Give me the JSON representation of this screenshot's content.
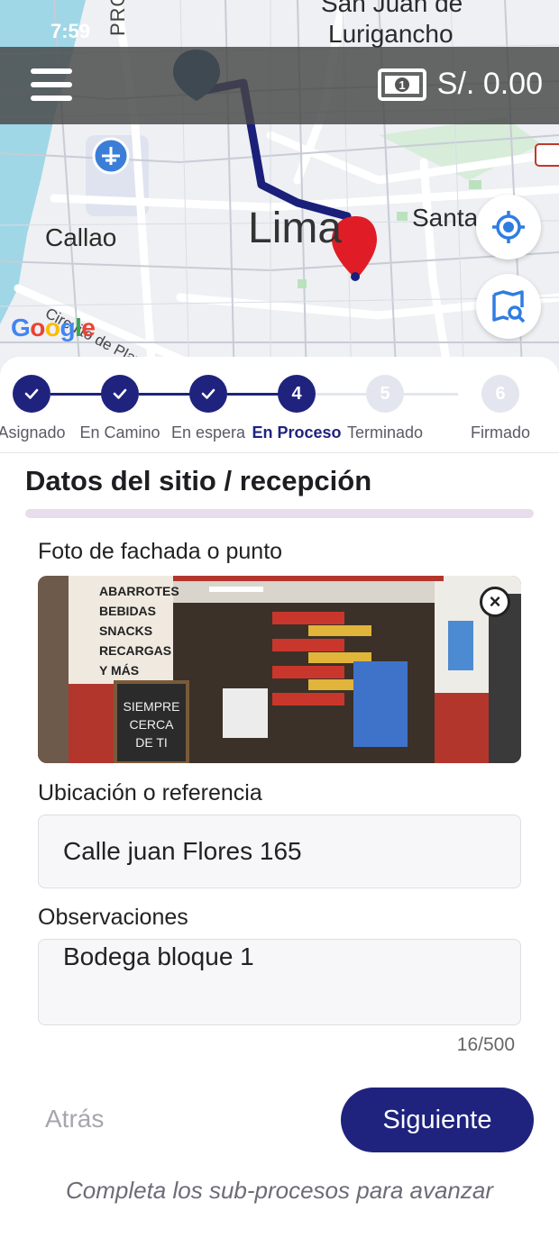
{
  "status_bar": {
    "time": "7:59"
  },
  "header": {
    "balance": "S/. 0.00",
    "menu_icon": "hamburger-menu-icon",
    "wallet_icon": "money-bill-icon"
  },
  "map": {
    "labels": {
      "callao": "Callao",
      "lima": "Lima",
      "santa": "Santa",
      "sj_line1": "San Juan de",
      "sj_line2": "Lurigancho",
      "circuito": "Circuito de Playas",
      "provincia": "PROVIN"
    },
    "google": [
      "G",
      "o",
      "o",
      "g",
      "l",
      "e"
    ],
    "route_color": "#1a1f7a",
    "pin_destination_color": "#e01d26",
    "pin_origin_color": "#1e5c86"
  },
  "stepper": {
    "steps": [
      {
        "label": "Asignado",
        "state": "done"
      },
      {
        "label": "En Camino",
        "state": "done"
      },
      {
        "label": "En espera",
        "state": "done"
      },
      {
        "label": "En Proceso",
        "number": "4",
        "state": "active"
      },
      {
        "label": "Terminado",
        "number": "5",
        "state": "todo"
      },
      {
        "label": "Firmado",
        "number": "6",
        "state": "todo"
      }
    ]
  },
  "form": {
    "title": "Datos del sitio / recepción",
    "photo_label": "Foto de fachada o punto",
    "photo_sign_lines": [
      "ABARROTES",
      "BEBIDAS",
      "SNACKS",
      "RECARGAS",
      "Y MÁS"
    ],
    "photo_board_lines": [
      "SIEMPRE",
      "CERCA",
      "DE TI"
    ],
    "ref_label": "Ubicación o referencia",
    "ref_value": "Calle juan Flores 165",
    "obs_label": "Observaciones",
    "obs_value": "Bodega bloque 1",
    "counter": "16/500"
  },
  "actions": {
    "back_label": "Atrás",
    "next_label": "Siguiente",
    "hint": "Completa los sub-procesos para avanzar"
  },
  "colors": {
    "primary": "#1f237e",
    "inactive_step": "#e3e6ef",
    "title_bar": "#e7ddef"
  }
}
